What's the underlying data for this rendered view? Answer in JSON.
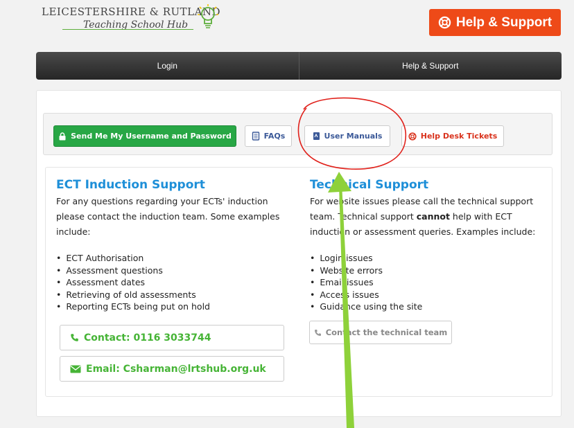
{
  "logo": {
    "line1": "LEICESTERSHIRE & RUTLAND",
    "line2": "Teaching School Hub"
  },
  "header": {
    "help_label": "Help & Support"
  },
  "nav": {
    "items": [
      "Login",
      "Help & Support"
    ]
  },
  "toolbar": {
    "send_label": "Send Me My Username and Password",
    "faqs_label": "FAQs",
    "manuals_label": "User Manuals",
    "tickets_label": "Help Desk Tickets"
  },
  "ect": {
    "title": "ECT Induction Support",
    "intro": "For any questions regarding your ECTs' induction please contact the induction team. Some examples include:",
    "items": [
      "ECT Authorisation",
      "Assessment questions",
      "Assessment dates",
      "Retrieving of old assessments",
      "Reporting ECTs being put on hold"
    ],
    "contact": "Contact: 0116 3033744",
    "email": "Email: Csharman@lrtshub.org.uk"
  },
  "tech": {
    "title": "Technical Support",
    "intro_a": "For website issues please call the technical support team. Technical support ",
    "intro_bold": "cannot",
    "intro_b": " help with ECT induction or assessment queries. Examples include:",
    "items": [
      "Login issues",
      "Website errors",
      "Email issues",
      "Access issues",
      "Guidance using the site"
    ],
    "button": "Contact the technical team"
  },
  "colors": {
    "brand_orange": "#ee4a18",
    "green": "#28a745",
    "link_blue": "#1e8fd8",
    "annotation_red": "#e0201a",
    "annotation_arrow": "#8ed13a"
  },
  "icons": [
    "lifebuoy-icon",
    "lock-icon",
    "book-icon",
    "manual-icon",
    "phone-icon",
    "envelope-icon",
    "bulb-icon"
  ]
}
